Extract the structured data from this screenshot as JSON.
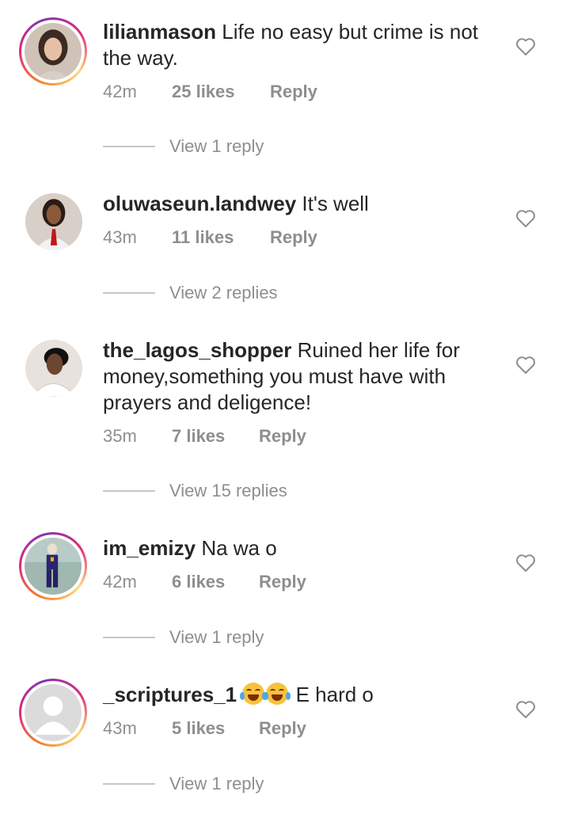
{
  "comments": [
    {
      "username": "lilianmason",
      "text": "Life no easy but crime is not the way.",
      "time": "42m",
      "likes": "25 likes",
      "reply": "Reply",
      "view_replies": "View 1 reply",
      "avatar_story_ring": true,
      "avatar": "photo-woman-smiling"
    },
    {
      "username": "oluwaseun.landwey",
      "text": "It's well",
      "time": "43m",
      "likes": "11 likes",
      "reply": "Reply",
      "view_replies": "View 2 replies",
      "avatar_story_ring": false,
      "avatar": "photo-woman-red-tie"
    },
    {
      "username": "the_lagos_shopper",
      "text": "Ruined her life for money,something you must have with prayers and deligence!",
      "time": "35m",
      "likes": "7 likes",
      "reply": "Reply",
      "view_replies": "View 15 replies",
      "avatar_story_ring": false,
      "avatar": "photo-woman-white-top"
    },
    {
      "username": "im_emizy",
      "text": "Na wa o",
      "time": "42m",
      "likes": "6 likes",
      "reply": "Reply",
      "view_replies": "View 1 reply",
      "avatar_story_ring": true,
      "avatar": "photo-man-standing"
    },
    {
      "username": "_scriptures_1",
      "emoji": "face-with-tears-of-joy x2",
      "text": "E hard o",
      "time": "43m",
      "likes": "5 likes",
      "reply": "Reply",
      "view_replies": "View 1 reply",
      "avatar_story_ring": true,
      "avatar": "default-avatar-icon"
    }
  ],
  "colors": {
    "text_primary": "#262626",
    "text_secondary": "#8e8e8e",
    "divider": "#c7c7c7"
  }
}
